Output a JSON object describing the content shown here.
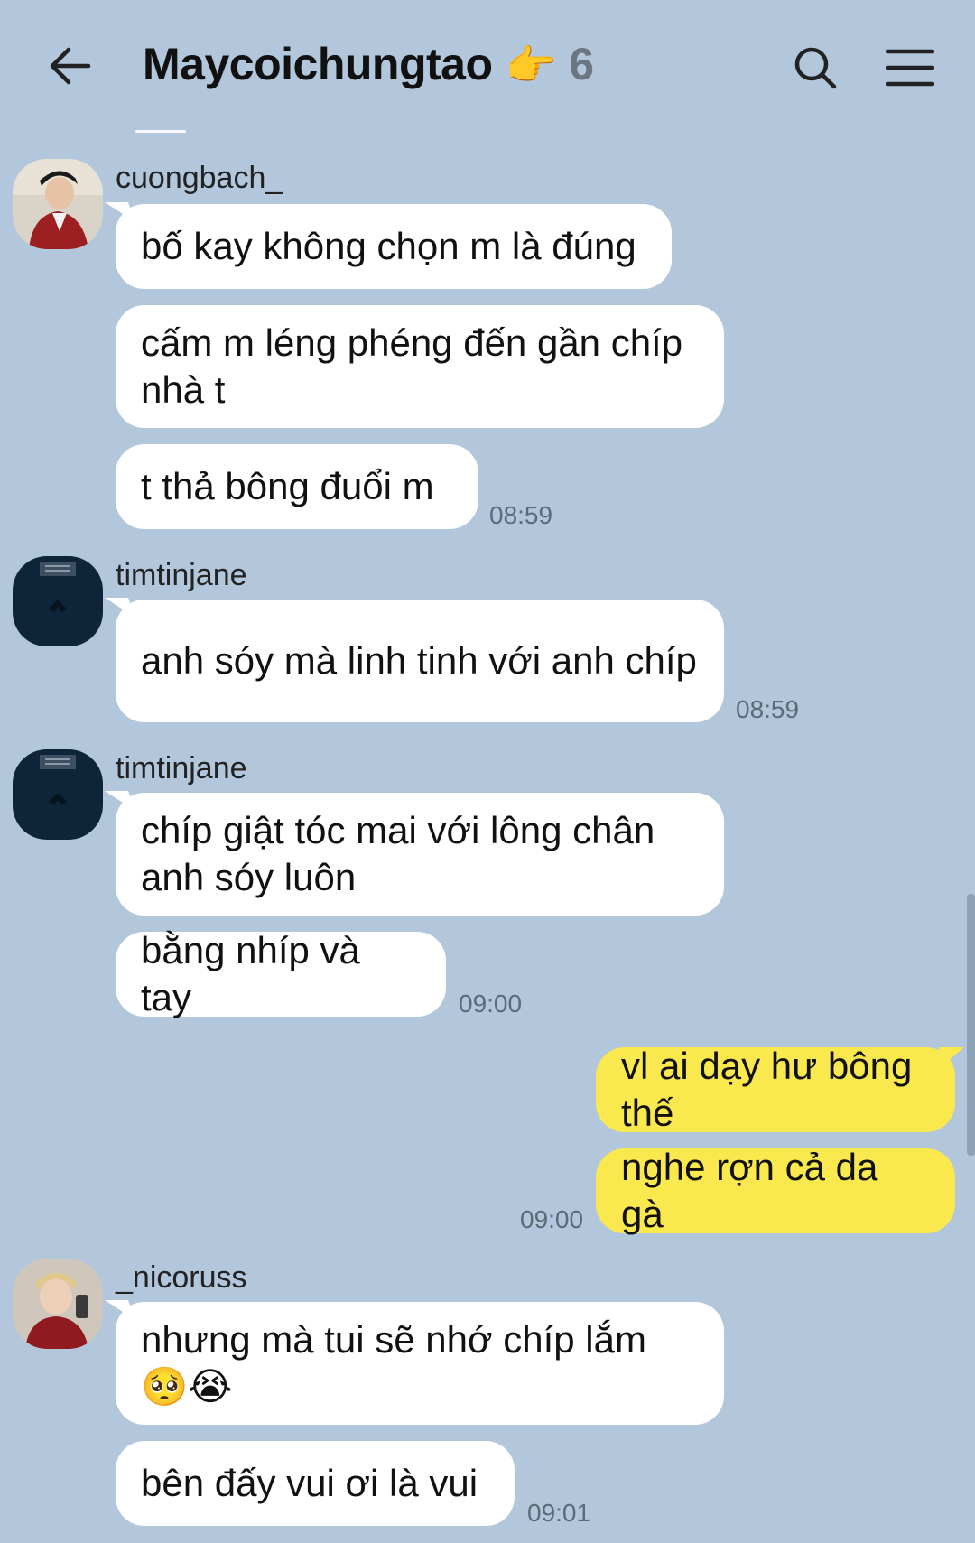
{
  "header": {
    "title": "Maycoichungtao",
    "title_emoji": "👉",
    "member_count": "6"
  },
  "messages": [
    {
      "sender": "cuongbach_",
      "bubbles": [
        "bố kay không chọn m là đúng",
        "cấm m léng phéng đến gần chíp nhà t",
        "t thả bông đuổi m"
      ],
      "time": "08:59"
    },
    {
      "sender": "timtinjane",
      "bubbles": [
        "anh sóy mà linh tinh với anh chíp"
      ],
      "time": "08:59"
    },
    {
      "sender": "timtinjane",
      "bubbles": [
        "chíp giật tóc mai với lông chân anh sóy luôn",
        "bằng nhíp và tay"
      ],
      "time": "09:00"
    },
    {
      "sender": "me",
      "bubbles": [
        "vl ai dạy hư bông thế",
        "nghe rợn cả da gà"
      ],
      "time": "09:00"
    },
    {
      "sender": "_nicoruss",
      "bubbles": [
        "nhưng mà tui sẽ nhớ chíp lắm 🥺😭",
        "bên đấy vui ơi là vui"
      ],
      "time": "09:01"
    }
  ],
  "icons": {
    "back": "arrow-left-icon",
    "search": "search-icon",
    "menu": "hamburger-menu-icon"
  },
  "colors": {
    "background": "#b3c7dc",
    "incoming_bubble": "#ffffff",
    "outgoing_bubble": "#fae84f"
  }
}
